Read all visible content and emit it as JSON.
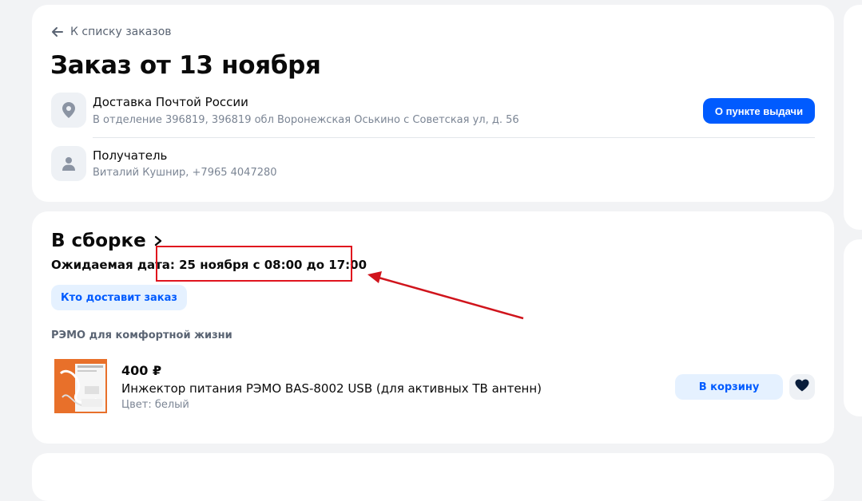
{
  "header": {
    "back_label": "К списку заказов",
    "title": "Заказ от 13 ноября"
  },
  "delivery": {
    "title": "Доставка Почтой России",
    "address": "В отделение 396819, 396819 обл Воронежская Оськино с Советская ул, д. 56",
    "pickup_button": "О пункте выдачи"
  },
  "recipient": {
    "title": "Получатель",
    "details": "Виталий Кушнир, +7965 4047280"
  },
  "shipment": {
    "status": "В сборке",
    "expected_label": "Ожидаемая дата:",
    "expected_value": "25 ноября с 08:00 до 17:00",
    "who_delivers_button": "Кто доставит заказ",
    "seller": "РЭМО для комфортной жизни"
  },
  "product": {
    "price": "400 ₽",
    "name": "Инжектор питания РЭМО BAS-8002 USB (для активных ТВ антенн)",
    "color": "Цвет: белый",
    "cart_button": "В корзину"
  },
  "colors": {
    "accent": "#005bff",
    "accent_light": "#e5f1ff",
    "highlight": "#e0141e"
  }
}
